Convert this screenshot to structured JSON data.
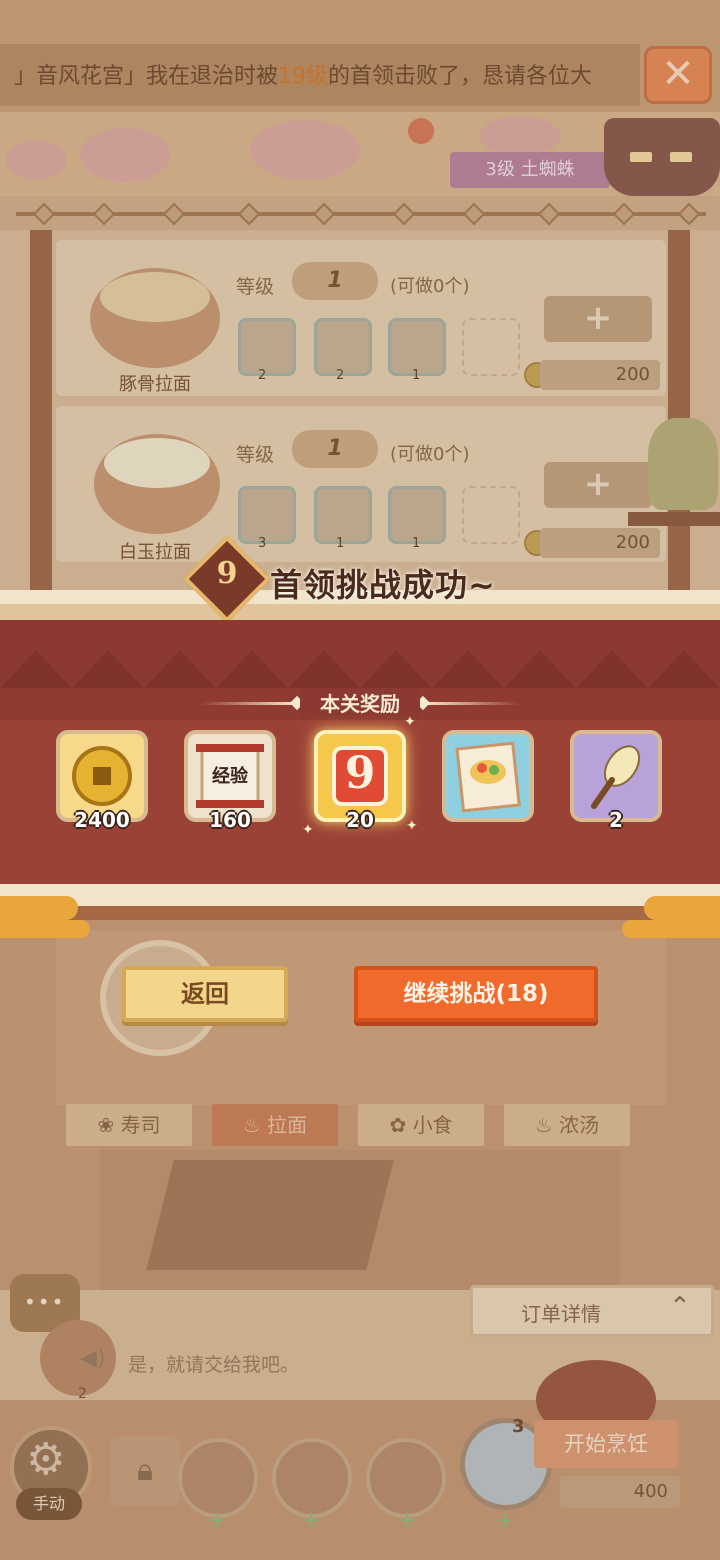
{
  "marquee": {
    "prefix": "」音风花宫」我在退治时被",
    "level": "19级",
    "suffix": "的首领击败了，恳请各位大"
  },
  "close_icon": "close-icon",
  "boss": {
    "tag": "3级 土蜘蛛"
  },
  "recipes": [
    {
      "name": "豚骨拉面",
      "level_label": "等级",
      "level": "1",
      "can_make": "(可做0个)",
      "ingredients": [
        {
          "icon": "radish-icon",
          "count": "2"
        },
        {
          "icon": "seaweed-icon",
          "count": "2"
        },
        {
          "icon": "noodle-icon",
          "count": "1"
        }
      ],
      "plus_label": "+",
      "price": "200"
    },
    {
      "name": "白玉拉面",
      "level_label": "等级",
      "level": "1",
      "can_make": "(可做0个)",
      "ingredients": [
        {
          "icon": "corn-icon",
          "count": "3"
        },
        {
          "icon": "tofu-icon",
          "count": "1"
        },
        {
          "icon": "noodle-icon",
          "count": "1"
        }
      ],
      "plus_label": "+",
      "price": "200"
    }
  ],
  "result": {
    "stage": "9",
    "title": "首领挑战成功~",
    "rewards_header": "本关奖励",
    "rewards": [
      {
        "icon": "gold-coin-icon",
        "count": "2400"
      },
      {
        "icon": "exp-scroll-icon",
        "label": "经验",
        "count": "160"
      },
      {
        "icon": "stage-token-icon",
        "label": "9",
        "count": "20"
      },
      {
        "icon": "recipe-book-icon",
        "count": ""
      },
      {
        "icon": "whisk-icon",
        "count": "2"
      }
    ],
    "back_label": "返回",
    "continue_label": "继续挑战(18)"
  },
  "tabs": [
    {
      "icon": "sushi-icon",
      "label": "寿司"
    },
    {
      "icon": "ramen-icon",
      "label": "拉面"
    },
    {
      "icon": "snack-icon",
      "label": "小食"
    },
    {
      "icon": "soup-icon",
      "label": "浓汤"
    }
  ],
  "chat": {
    "icon": "chat-icon",
    "order_label": "订单详情",
    "message": "是，就请交给我吧。",
    "side_count": "2"
  },
  "bottom": {
    "manual_label": "手动",
    "chef_count": "3",
    "start_label": "开始烹饪",
    "cost": "400"
  },
  "colors": {
    "accent_orange": "#f06a2b",
    "popup_red": "#8f3b32",
    "gold": "#e8a63c"
  }
}
